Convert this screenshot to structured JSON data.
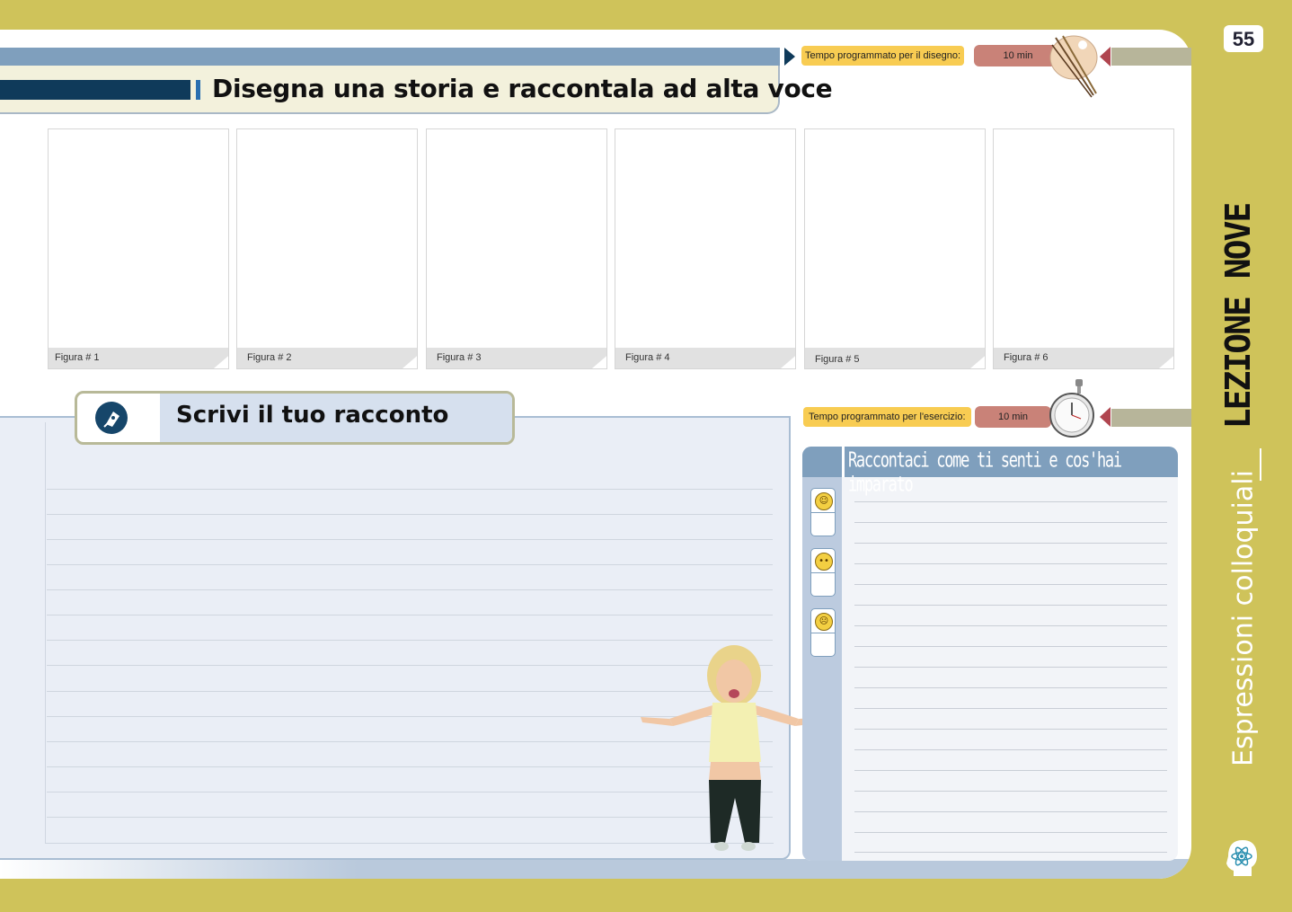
{
  "page": {
    "number": "55"
  },
  "header": {
    "title": "Disegna una storia e raccontala ad alta voce",
    "timer": {
      "label": "Tempo programmato per il disegno:",
      "value": "10 min",
      "icon": "paintbrush-palette-icon"
    }
  },
  "figures": [
    {
      "label": "Figura # 1"
    },
    {
      "label": "Figura # 2"
    },
    {
      "label": "Figura # 3"
    },
    {
      "label": "Figura # 4"
    },
    {
      "label": "Figura # 5"
    },
    {
      "label": "Figura # 6"
    }
  ],
  "write": {
    "title": "Scrivi il tuo racconto",
    "icon": "pen-nib-icon"
  },
  "exercise": {
    "timer": {
      "label": "Tempo programmato per l'esercizio:",
      "value": "10 min",
      "icon": "stopwatch-icon"
    },
    "feelings": {
      "title": "Raccontaci come ti senti e cos'hai imparato",
      "moods": [
        "happy-face-icon",
        "neutral-face-icon",
        "sad-face-icon"
      ]
    }
  },
  "sidebar": {
    "title": "LEZIONE NOVE",
    "subtitle": "Espressioni colloquiali",
    "icon": "atom-head-icon"
  },
  "colors": {
    "accent": "#cfc35a",
    "navy": "#0f3a5a",
    "steel": "#7f9fbd",
    "timer": "#f8cc52"
  }
}
